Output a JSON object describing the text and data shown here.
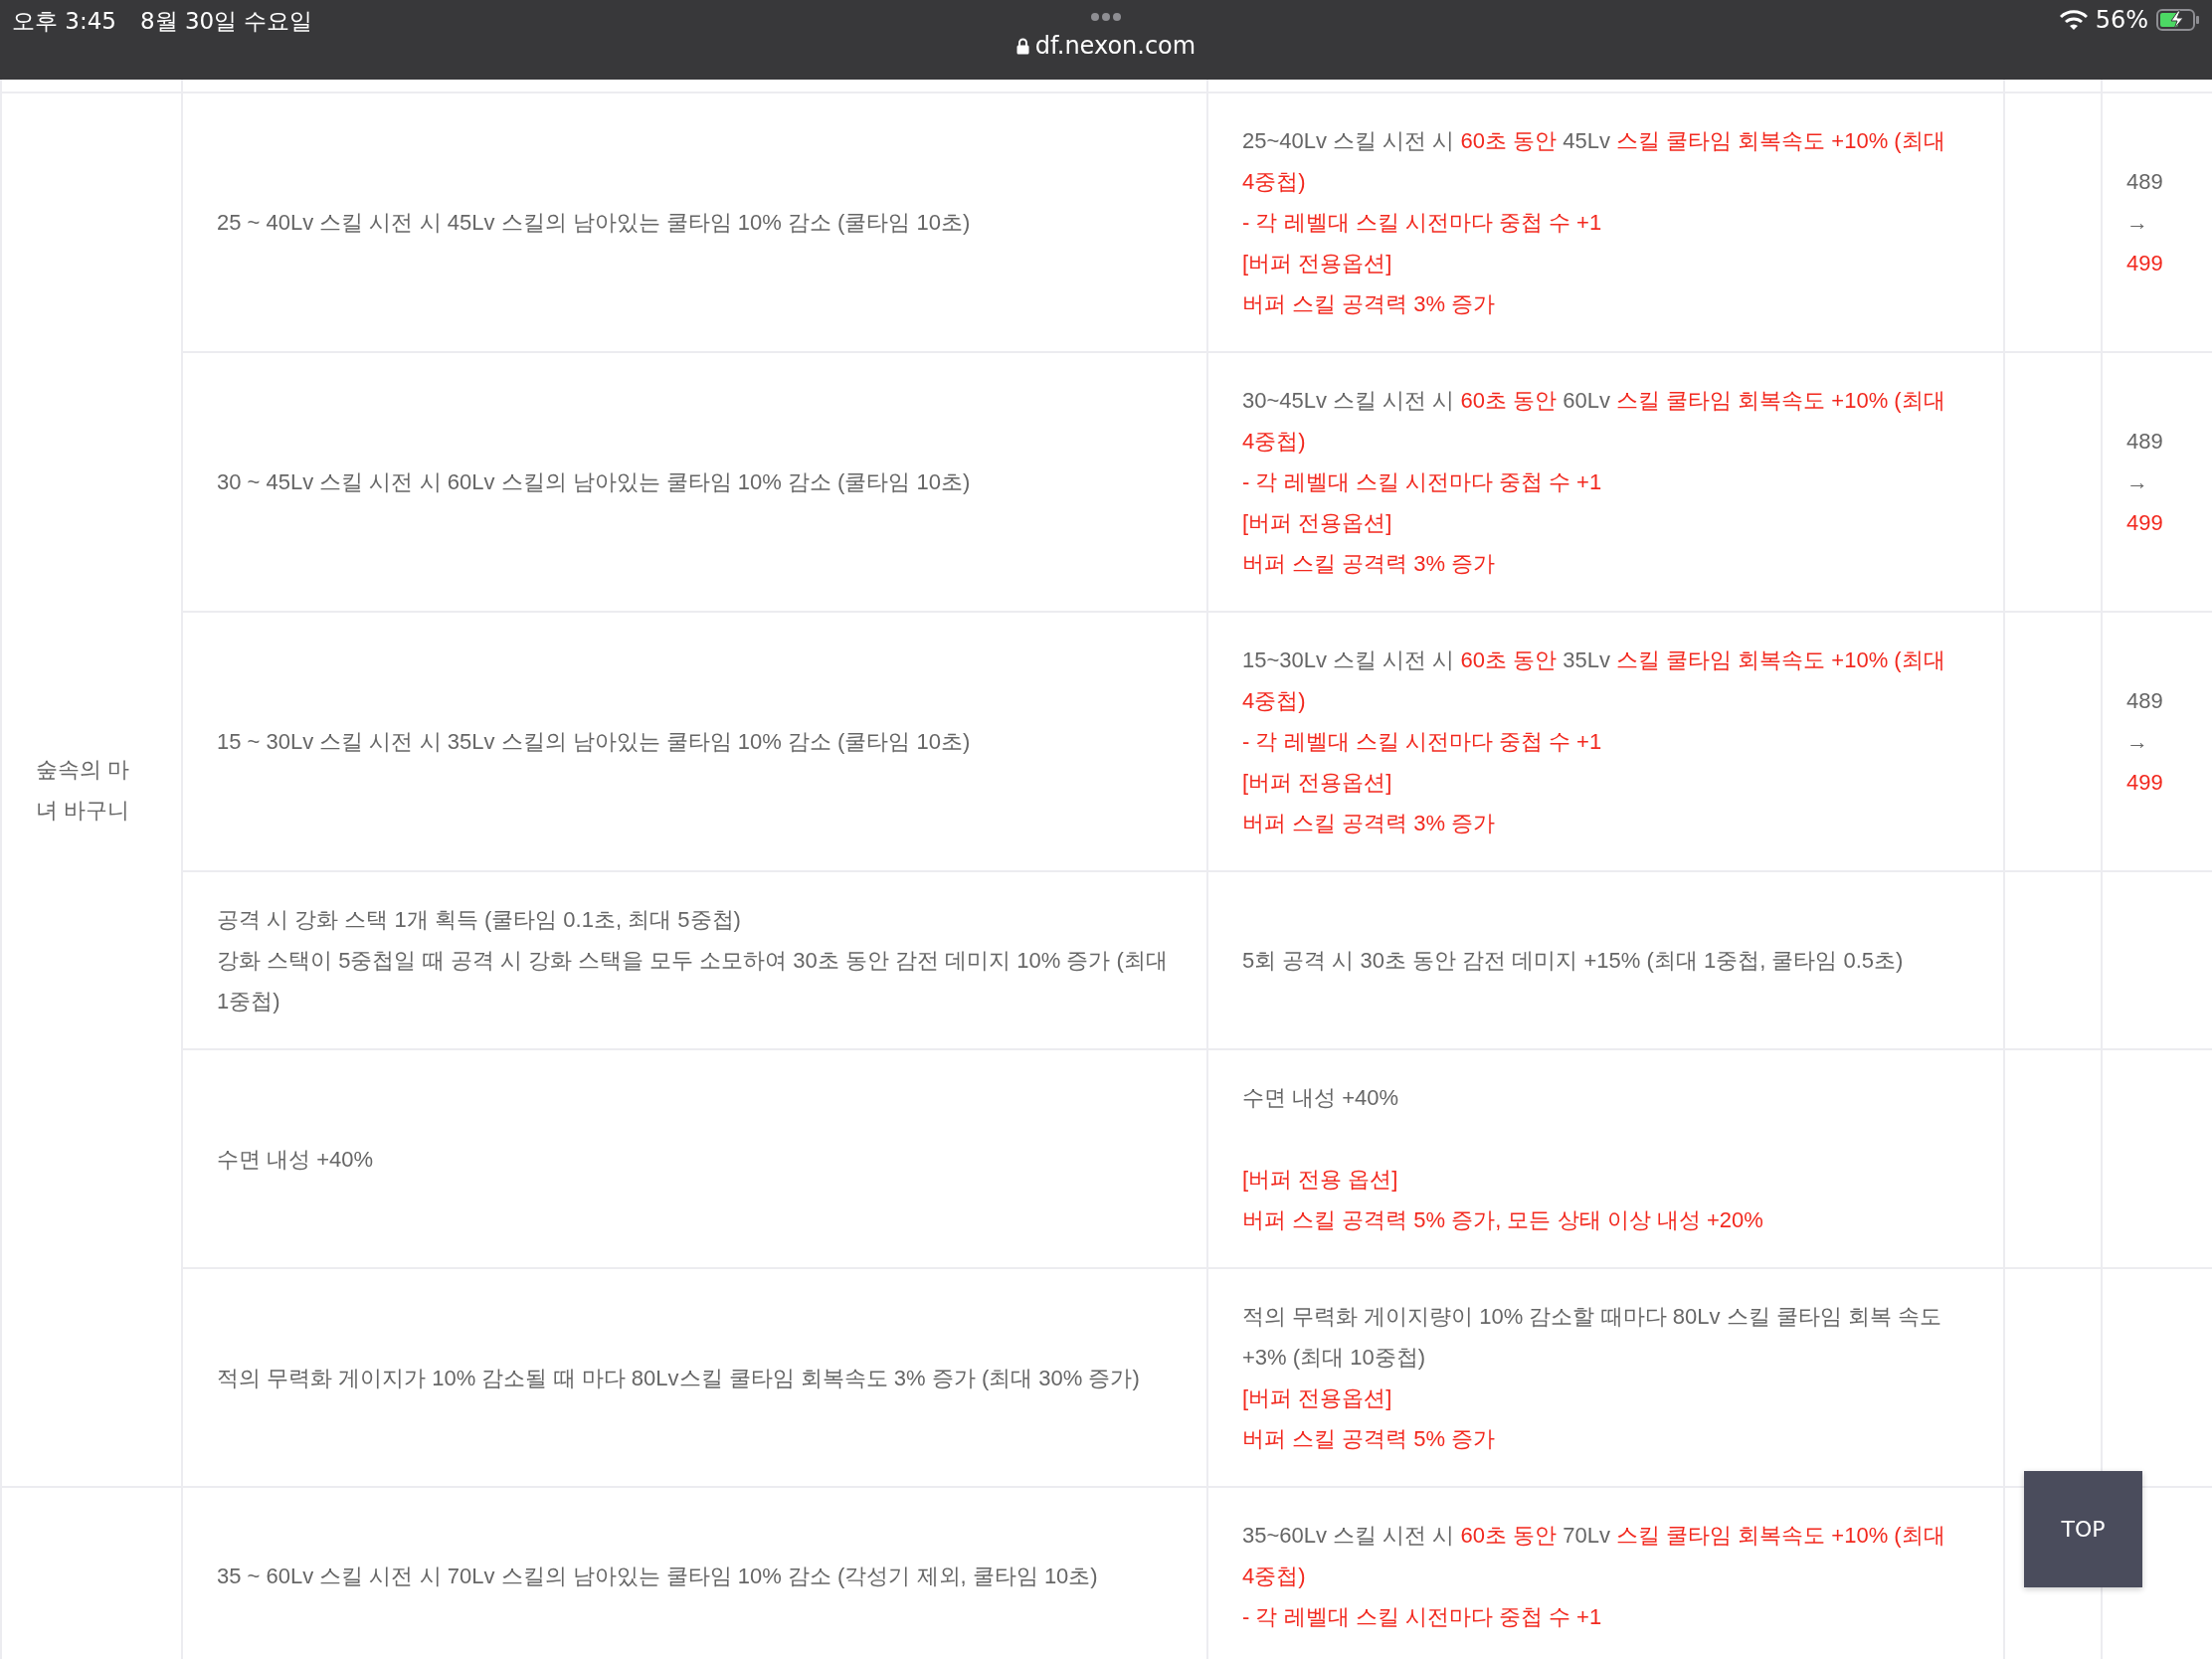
{
  "status_bar": {
    "time": "오후 3:45",
    "date": "8월 30일 수요일",
    "url": "df.nexon.com",
    "battery": "56%"
  },
  "table": {
    "groups": [
      {
        "name": "숲속의 마녀 바구니",
        "rows": [
          {
            "before": [
              "25 ~ 40Lv 스킬 시전 시 45Lv 스킬의 남아있는 쿨타임 10% 감소 (쿨타임 10초)"
            ],
            "after": [
              {
                "segments": [
                  {
                    "text": "25~40Lv 스킬 시전 시 ",
                    "highlight": false
                  },
                  {
                    "text": "60초 동안",
                    "highlight": true
                  },
                  {
                    "text": " 45Lv ",
                    "highlight": false
                  },
                  {
                    "text": "스킬 쿨타임 회복속도 +10% (최대 4중첩)",
                    "highlight": true
                  }
                ]
              },
              {
                "segments": [
                  {
                    "text": "- 각 레벨대 스킬 시전마다 중첩 수 +1",
                    "highlight": true
                  }
                ]
              },
              {
                "segments": [
                  {
                    "text": "[버퍼 전용옵션]",
                    "highlight": true
                  }
                ]
              },
              {
                "segments": [
                  {
                    "text": "버퍼 스킬 공격력 3% 증가",
                    "highlight": true
                  }
                ]
              }
            ],
            "change": {
              "from": "489",
              "arrow": "→",
              "to": "499"
            }
          },
          {
            "before": [
              "30 ~ 45Lv 스킬 시전 시 60Lv 스킬의 남아있는 쿨타임 10% 감소 (쿨타임 10초)"
            ],
            "after": [
              {
                "segments": [
                  {
                    "text": "30~45Lv 스킬 시전 시 ",
                    "highlight": false
                  },
                  {
                    "text": "60초 동안",
                    "highlight": true
                  },
                  {
                    "text": " 60Lv ",
                    "highlight": false
                  },
                  {
                    "text": "스킬 쿨타임 회복속도 +10% (최대 4중첩)",
                    "highlight": true
                  }
                ]
              },
              {
                "segments": [
                  {
                    "text": "- 각 레벨대 스킬 시전마다 중첩 수 +1",
                    "highlight": true
                  }
                ]
              },
              {
                "segments": [
                  {
                    "text": "[버퍼 전용옵션]",
                    "highlight": true
                  }
                ]
              },
              {
                "segments": [
                  {
                    "text": "버퍼 스킬 공격력 3% 증가",
                    "highlight": true
                  }
                ]
              }
            ],
            "change": {
              "from": "489",
              "arrow": "→",
              "to": "499"
            }
          },
          {
            "before": [
              "15 ~ 30Lv 스킬 시전 시 35Lv 스킬의 남아있는 쿨타임 10% 감소 (쿨타임 10초)"
            ],
            "after": [
              {
                "segments": [
                  {
                    "text": "15~30Lv 스킬 시전 시 ",
                    "highlight": false
                  },
                  {
                    "text": "60초 동안",
                    "highlight": true
                  },
                  {
                    "text": " 35Lv ",
                    "highlight": false
                  },
                  {
                    "text": "스킬 쿨타임 회복속도 +10% (최대 4중첩)",
                    "highlight": true
                  }
                ]
              },
              {
                "segments": [
                  {
                    "text": "- 각 레벨대 스킬 시전마다 중첩 수 +1",
                    "highlight": true
                  }
                ]
              },
              {
                "segments": [
                  {
                    "text": "[버퍼 전용옵션]",
                    "highlight": true
                  }
                ]
              },
              {
                "segments": [
                  {
                    "text": "버퍼 스킬 공격력 3% 증가",
                    "highlight": true
                  }
                ]
              }
            ],
            "change": {
              "from": "489",
              "arrow": "→",
              "to": "499"
            }
          },
          {
            "before": [
              "공격 시 강화 스택 1개 획득 (쿨타임 0.1초, 최대 5중첩)",
              "강화 스택이 5중첩일 때 공격 시 강화 스택을 모두 소모하여 30초 동안 감전 데미지 10% 증가 (최대 1중첩)"
            ],
            "after": [
              {
                "segments": [
                  {
                    "text": "5회 공격 시 30초 동안 감전 데미지 +15% (최대 1중첩, 쿨타임 0.5초)",
                    "highlight": false
                  }
                ]
              }
            ]
          },
          {
            "before": [
              "수면 내성 +40%"
            ],
            "after": [
              {
                "segments": [
                  {
                    "text": "수면 내성 +40%",
                    "highlight": false
                  }
                ]
              },
              {
                "space_before": true,
                "segments": [
                  {
                    "text": "[버퍼 전용 옵션]",
                    "highlight": true
                  }
                ]
              },
              {
                "segments": [
                  {
                    "text": "버퍼 스킬 공격력 5% 증가, 모든 상태 이상 내성 +20%",
                    "highlight": true
                  }
                ]
              }
            ]
          },
          {
            "before": [
              "적의 무력화 게이지가 10% 감소될 때 마다 80Lv스킬 쿨타임 회복속도 3% 증가 (최대 30% 증가)"
            ],
            "after": [
              {
                "segments": [
                  {
                    "text": "적의 무력화 게이지량이 10% 감소할 때마다 80Lv 스킬 쿨타임 회복 속도 +3% (최대 10중첩)",
                    "highlight": false
                  }
                ]
              },
              {
                "segments": [
                  {
                    "text": "[버퍼 전용옵션]",
                    "highlight": true
                  }
                ]
              },
              {
                "segments": [
                  {
                    "text": "버퍼 스킬 공격력 5% 증가",
                    "highlight": true
                  }
                ]
              }
            ]
          }
        ]
      },
      {
        "rows": [
          {
            "before": [
              "35 ~ 60Lv 스킬 시전 시 70Lv 스킬의 남아있는 쿨타임 10% 감소 (각성기 제외, 쿨타임 10초)"
            ],
            "after": [
              {
                "segments": [
                  {
                    "text": "35~60Lv 스킬 시전 시 ",
                    "highlight": false
                  },
                  {
                    "text": "60초 동안",
                    "highlight": true
                  },
                  {
                    "text": " 70Lv ",
                    "highlight": false
                  },
                  {
                    "text": "스킬 쿨타임 회복속도 +10% (최대 4중첩)",
                    "highlight": true
                  }
                ]
              },
              {
                "segments": [
                  {
                    "text": "- 각 레벨대 스킬 시전마다 중첩 수 +1",
                    "highlight": true
                  }
                ]
              }
            ]
          }
        ]
      }
    ]
  },
  "top_button": "TOP"
}
